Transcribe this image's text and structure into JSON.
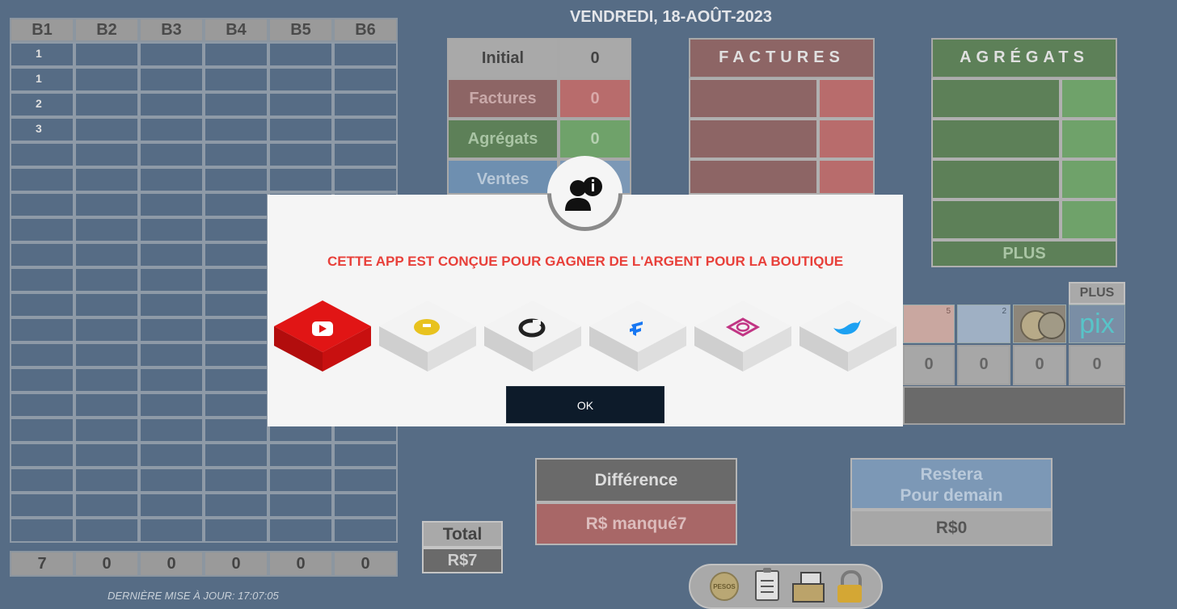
{
  "date_title": "VENDREDI, 18-AOÛT-2023",
  "grid": {
    "headers": [
      "B1",
      "B2",
      "B3",
      "B4",
      "B5",
      "B6"
    ],
    "rows": [
      [
        "1",
        "",
        "",
        "",
        "",
        ""
      ],
      [
        "1",
        "",
        "",
        "",
        "",
        ""
      ],
      [
        "2",
        "",
        "",
        "",
        "",
        ""
      ],
      [
        "3",
        "",
        "",
        "",
        "",
        ""
      ],
      [
        "",
        "",
        "",
        "",
        "",
        ""
      ],
      [
        "",
        "",
        "",
        "",
        "",
        ""
      ],
      [
        "",
        "",
        "",
        "",
        "",
        ""
      ],
      [
        "",
        "",
        "",
        "",
        "",
        ""
      ],
      [
        "",
        "",
        "",
        "",
        "",
        ""
      ],
      [
        "",
        "",
        "",
        "",
        "",
        ""
      ],
      [
        "",
        "",
        "",
        "",
        "",
        ""
      ],
      [
        "",
        "",
        "",
        "",
        "",
        ""
      ],
      [
        "",
        "",
        "",
        "",
        "",
        ""
      ],
      [
        "",
        "",
        "",
        "",
        "",
        ""
      ],
      [
        "",
        "",
        "",
        "",
        "",
        ""
      ],
      [
        "",
        "",
        "",
        "",
        "",
        ""
      ],
      [
        "",
        "",
        "",
        "",
        "",
        ""
      ],
      [
        "",
        "",
        "",
        "",
        "",
        ""
      ],
      [
        "",
        "",
        "",
        "",
        "",
        ""
      ],
      [
        "",
        "",
        "",
        "",
        "",
        ""
      ]
    ],
    "totals": [
      "7",
      "0",
      "0",
      "0",
      "0",
      "0"
    ]
  },
  "last_update": "DERNIÈRE MISE À JOUR: 17:07:05",
  "summary": {
    "initial_label": "Initial",
    "initial_value": "0",
    "factures_label": "Factures",
    "factures_value": "0",
    "agregats_label": "Agrégats",
    "agregats_value": "0",
    "ventes_label": "Ventes"
  },
  "factures_title": "FACTURES",
  "agregats_title": "AGRÉGATS",
  "agregats_plus": "PLUS",
  "money": {
    "plus_label": "PLUS",
    "pix_label": "pix",
    "values": [
      "0",
      "0",
      "0",
      "0"
    ]
  },
  "total": {
    "label": "Total",
    "value": "R$7"
  },
  "difference": {
    "label": "Différence",
    "value": "R$ manqué7"
  },
  "restera": {
    "label_line1": "Restera",
    "label_line2": "Pour demain",
    "value": "R$0"
  },
  "modal": {
    "message": "CETTE APP EST CONÇUE POUR GAGNER DE L'ARGENT POUR LA BOUTIQUE",
    "ok_label": "OK",
    "tiles": [
      "youtube-icon",
      "coin-icon",
      "refresh-icon",
      "facebook-icon",
      "instagram-icon",
      "twitter-icon"
    ]
  },
  "toolbar": {
    "pesos_label": "PESOS"
  },
  "colors": {
    "red": "#b86c6c",
    "green": "#6fa26a",
    "blue": "#6e8fb0",
    "accent_red": "#e8403a",
    "ok_bg": "#0d1b2a"
  }
}
